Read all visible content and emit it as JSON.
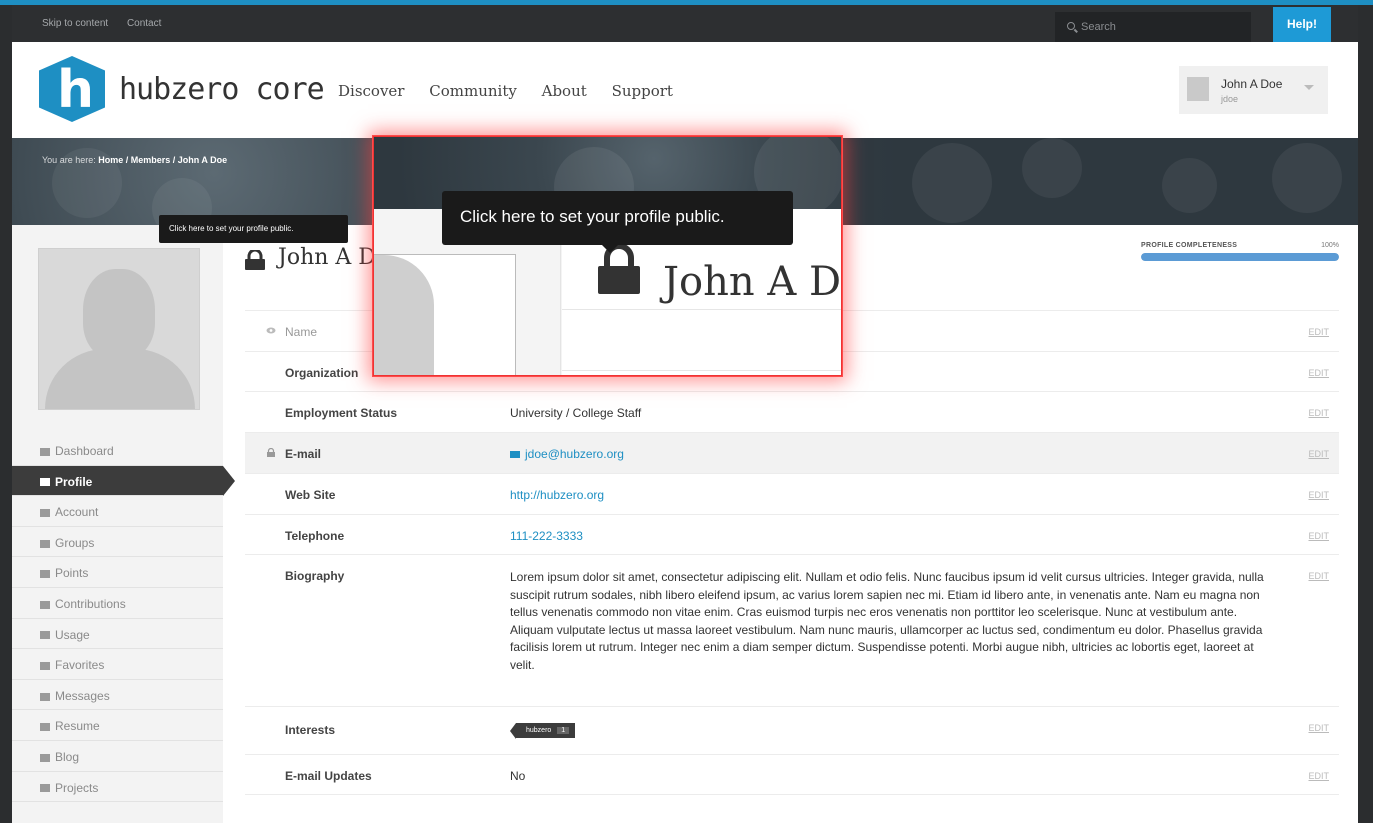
{
  "utility": {
    "skip": "Skip to content",
    "contact": "Contact",
    "search_placeholder": "Search",
    "help": "Help!"
  },
  "brand": {
    "logo_text": "hubzero core"
  },
  "nav": [
    "Discover",
    "Community",
    "About",
    "Support"
  ],
  "user": {
    "name": "John A Doe",
    "username": "jdoe"
  },
  "breadcrumb": {
    "prefix": "You are here:",
    "path": "Home / Members / John A Doe"
  },
  "profile": {
    "title": "John A Doe",
    "title_clipped": "John A D",
    "completeness_label": "PROFILE COMPLETENESS",
    "completeness_pct": "100%",
    "completeness_value": 100
  },
  "sidebar": [
    {
      "label": "Dashboard",
      "icon": "dashboard-icon"
    },
    {
      "label": "Profile",
      "icon": "user-icon",
      "active": true
    },
    {
      "label": "Account",
      "icon": "gear-icon"
    },
    {
      "label": "Groups",
      "icon": "groups-icon"
    },
    {
      "label": "Points",
      "icon": "points-icon"
    },
    {
      "label": "Contributions",
      "icon": "contributions-icon"
    },
    {
      "label": "Usage",
      "icon": "bar-chart-icon"
    },
    {
      "label": "Favorites",
      "icon": "heart-icon"
    },
    {
      "label": "Messages",
      "icon": "envelope-icon"
    },
    {
      "label": "Resume",
      "icon": "document-icon"
    },
    {
      "label": "Blog",
      "icon": "comment-icon"
    },
    {
      "label": "Projects",
      "icon": "send-icon"
    }
  ],
  "fields": {
    "edit": "EDIT",
    "name_label": "Name",
    "organization_label": "Organization",
    "employment_label": "Employment Status",
    "employment_value": "University / College Staff",
    "email_label": "E-mail",
    "email_value": "jdoe@hubzero.org",
    "website_label": "Web Site",
    "website_value": "http://hubzero.org",
    "telephone_label": "Telephone",
    "telephone_value": "111-222-3333",
    "biography_label": "Biography",
    "biography_value": "Lorem ipsum dolor sit amet, consectetur adipiscing elit. Nullam et odio felis. Nunc faucibus ipsum id velit cursus ultricies. Integer gravida, nulla suscipit rutrum sodales, nibh libero eleifend ipsum, ac varius lorem sapien nec mi. Etiam id libero ante, in venenatis ante. Nam eu magna non tellus venenatis commodo non vitae enim. Cras euismod turpis nec eros venenatis non porttitor leo scelerisque. Nunc at vestibulum ante. Aliquam vulputate lectus ut massa laoreet vestibulum. Nam nunc mauris, ullamcorper ac luctus sed, condimentum eu dolor. Phasellus gravida facilisis lorem ut rutrum. Integer nec enim a diam semper dictum. Suspendisse potenti. Morbi augue nibh, ultricies ac lobortis eget, laoreet at velit.",
    "interests_label": "Interests",
    "interest_tag": "hubzero",
    "interest_count": "1",
    "updates_label": "E-mail Updates",
    "updates_value": "No"
  },
  "tooltip": "Click here to set your profile public."
}
